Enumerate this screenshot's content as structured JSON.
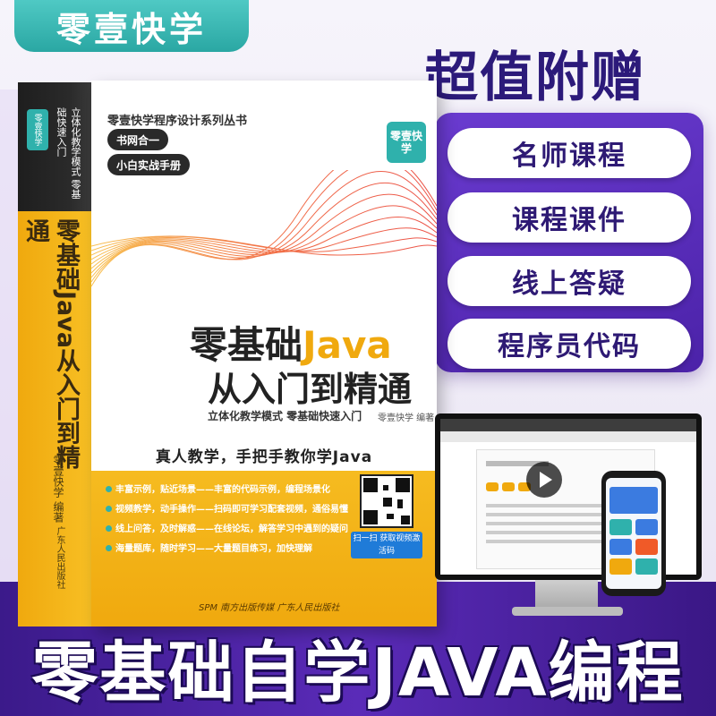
{
  "brand": "零壹快学",
  "gift": {
    "title": "超值附赠",
    "items": [
      "名师课程",
      "课程课件",
      "线上答疑",
      "程序员代码"
    ]
  },
  "spine": {
    "logo": "零壹快学",
    "subtitle": "立体化教学模式 零基础快速入门",
    "title": "零基础Java从入门到精通",
    "author": "零壹快学 编著",
    "publisher": "广东人民出版社"
  },
  "cover": {
    "series": "零壹快学程序设计系列丛书",
    "tags": [
      "书网合一",
      "小白实战手册"
    ],
    "badge": "零壹快学",
    "title_prefix": "零基础",
    "title_java": "Java",
    "title_line2": "从入门到精通",
    "subtitle": "立体化教学模式   零基础快速入门",
    "author": "零壹快学  编著",
    "slogan": "真人教学，手把手教你学Java",
    "bullets": [
      "丰富示例，贴近场景——丰富的代码示例，编程场景化",
      "视频教学，动手操作——扫码即可学习配套视频，通俗易懂",
      "线上问答，及时解惑——在线论坛，解答学习中遇到的疑问",
      "海量题库，随时学习——大量题目练习，加快理解"
    ],
    "qr_label": "扫一扫 获取视频激活码",
    "publisher": "SPM 南方出版传媒  广东人民出版社"
  },
  "banner": "零基础自学JAVA编程",
  "colors": {
    "teal": "#2fb1ac",
    "purple": "#4b22a8",
    "yellow": "#f7bf24",
    "navy": "#2c1a7a"
  }
}
